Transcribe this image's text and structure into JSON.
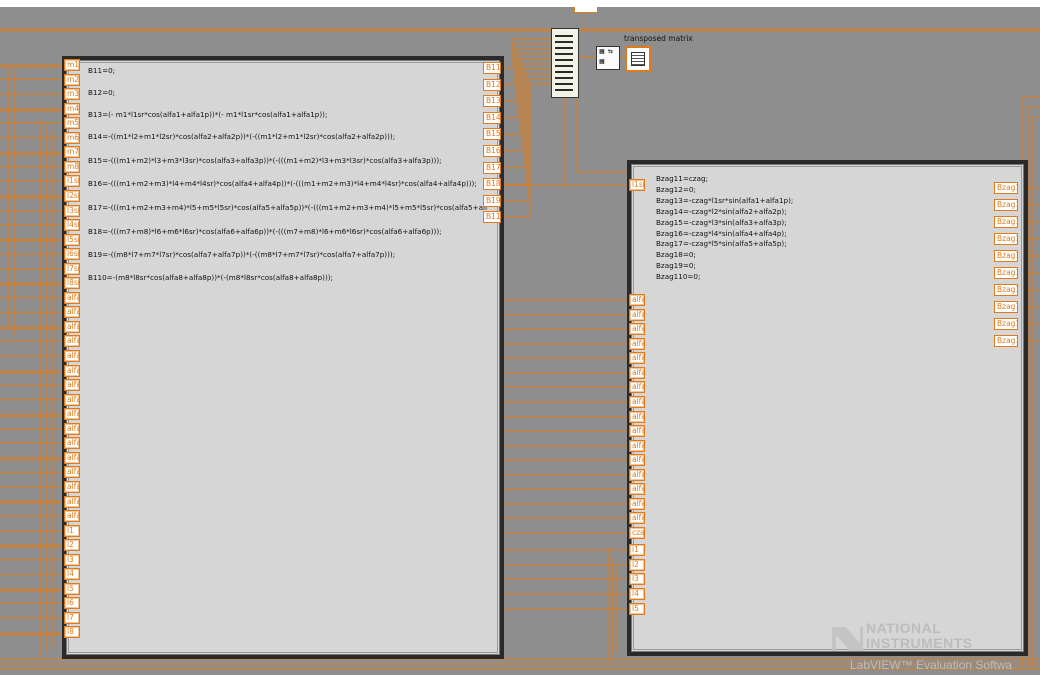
{
  "formula_node_1": {
    "code_lines": [
      "B11=0;",
      "B12=0;",
      "B13=(- m1*l1sr*cos(alfa1+alfa1p))*(- m1*l1sr*cos(alfa1+alfa1p));",
      "B14=-((m1*l2+m1*l2sr)*cos(alfa2+alfa2p))*(-((m1*l2+m1*l2sr)*cos(alfa2+alfa2p)));",
      "B15=-(((m1+m2)*l3+m3*l3sr)*cos(alfa3+alfa3p))*(-(((m1+m2)*l3+m3*l3sr)*cos(alfa3+alfa3p)));",
      "B16=-(((m1+m2+m3)*l4+m4*l4sr)*cos(alfa4+alfa4p))*(-(((m1+m2+m3)*l4+m4*l4sr)*cos(alfa4+alfa4p)));",
      "B17=-(((m1+m2+m3+m4)*l5+m5*l5sr)*cos(alfa5+alfa5p))*(-(((m1+m2+m3+m4)*l5+m5*l5sr)*cos(alfa5+alf",
      "B18=-(((m7+m8)*l6+m6*l6sr)*cos(alfa6+alfa6p))*(-(((m7+m8)*l6+m6*l6sr)*cos(alfa6+alfa6p)));",
      "B19=-((m8*l7+m7*l7sr)*cos(alfa7+alfa7p))*(-((m8*l7+m7*l7sr)*cos(alfa7+alfa7p)));",
      "B110=-(m8*l8sr*cos(alfa8+alfa8p))*(-(m8*l8sr*cos(alfa8+alfa8p)));"
    ],
    "inputs": [
      "m1",
      "m2",
      "m3",
      "m4",
      "m5",
      "m6",
      "m7",
      "m8",
      "l1sr",
      "l2sr",
      "l3sr",
      "l4sr",
      "l5sr",
      "l6sr",
      "l7sr",
      "l8sr",
      "alfa1p",
      "alfa2p",
      "alfa3p",
      "alfa4p",
      "alfa5p",
      "alfa6p",
      "alfa7p",
      "alfa8p",
      "alfa1",
      "alfa2",
      "alfa3",
      "alfa4",
      "alfa5",
      "alfa6",
      "alfa7",
      "alfa8",
      "l1",
      "l2",
      "l3",
      "l4",
      "l5",
      "l6",
      "l7",
      "l8"
    ],
    "outputs": [
      "B11",
      "B12",
      "B13",
      "B14",
      "B15",
      "B16",
      "B17",
      "B18",
      "B19",
      "B110"
    ]
  },
  "formula_node_2": {
    "code_lines": [
      "Bzag11=czag;",
      "Bzag12=0;",
      "Bzag13=-czag*l1sr*sin(alfa1+alfa1p);",
      "Bzag14=-czag*l2*sin(alfa2+alfa2p);",
      "Bzag15=-czag*l3*sin(alfa3+alfa3p);",
      "Bzag16=-czag*l4*sin(alfa4+alfa4p);",
      "Bzag17=-czag*l5*sin(alfa5+alfa5p);",
      "Bzag18=0;",
      "Bzag19=0;",
      "Bzag110=0;"
    ],
    "inputs": [
      "l1sr",
      "alfa1p",
      "alfa2p",
      "alfa3p",
      "alfa4p",
      "alfa5p",
      "alfa6p",
      "alfa7p",
      "alfa8p",
      "alfa1",
      "alfa2",
      "alfa3",
      "alfa4",
      "alfa5",
      "alfa6",
      "alfa7",
      "alfa8",
      "czag",
      "l1",
      "l2",
      "l3",
      "l4",
      "l5"
    ],
    "outputs": [
      "Bzag11",
      "Bzag12",
      "Bzag13",
      "Bzag14",
      "Bzag15",
      "Bzag16",
      "Bzag17",
      "Bzag18",
      "Bzag19",
      "Bzag110"
    ]
  },
  "indicator": {
    "label": "transposed matrix"
  },
  "icons": {
    "build_array": "build-array-icon",
    "transpose": "transpose-matrix-icon",
    "indicator": "2d-array-indicator-icon"
  },
  "watermark": {
    "line1": "NATIONAL",
    "line2": "INSTRUMENTS",
    "line3": "LabVIEW™ Evaluation Softwa"
  },
  "colors": {
    "wire": "#e07a1a",
    "canvas": "#8e8e8e",
    "node_bg": "#d6d6d6",
    "node_border": "#2a2a2a"
  }
}
